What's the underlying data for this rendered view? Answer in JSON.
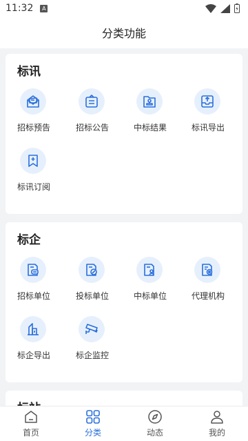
{
  "status_bar": {
    "time": "11:32",
    "a_icon": "A"
  },
  "header": {
    "title": "分类功能"
  },
  "sections": [
    {
      "title": "标讯",
      "items": [
        {
          "label": "招标预告",
          "icon": "mail-open-icon"
        },
        {
          "label": "招标公告",
          "icon": "notice-board-icon"
        },
        {
          "label": "中标结果",
          "icon": "stamp-folder-icon"
        },
        {
          "label": "标讯导出",
          "icon": "export-tray-icon"
        },
        {
          "label": "标讯订阅",
          "icon": "bookmark-plus-icon"
        }
      ]
    },
    {
      "title": "标企",
      "items": [
        {
          "label": "招标单位",
          "icon": "doc-chat-icon"
        },
        {
          "label": "投标单位",
          "icon": "doc-pen-icon"
        },
        {
          "label": "中标单位",
          "icon": "doc-user-icon"
        },
        {
          "label": "代理机构",
          "icon": "doc-gear-icon"
        },
        {
          "label": "标企导出",
          "icon": "buildings-icon"
        },
        {
          "label": "标企监控",
          "icon": "camera-icon"
        }
      ]
    },
    {
      "title": "标站"
    }
  ],
  "tabs": [
    {
      "label": "首页",
      "icon": "home-icon",
      "active": false
    },
    {
      "label": "分类",
      "icon": "grid-icon",
      "active": true
    },
    {
      "label": "动态",
      "icon": "compass-icon",
      "active": false
    },
    {
      "label": "我的",
      "icon": "user-icon",
      "active": false
    }
  ],
  "colors": {
    "accent": "#2a6fdb",
    "icon_bg": "#e6f0fc"
  }
}
